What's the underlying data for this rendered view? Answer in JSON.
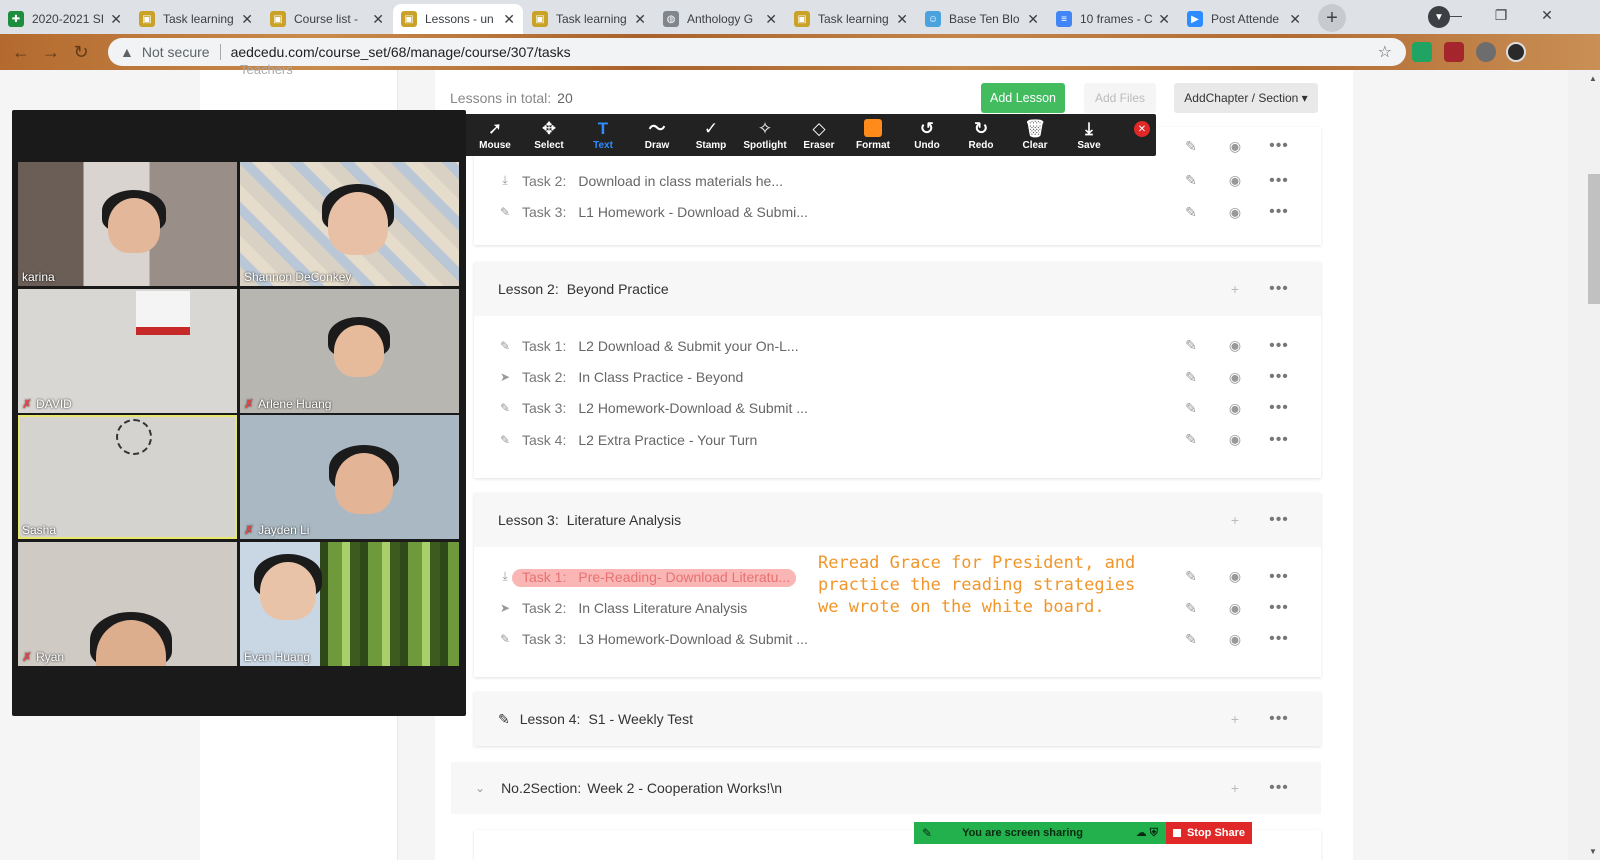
{
  "browser": {
    "tabs": [
      {
        "title": "2020-2021 SI",
        "favicon_color": "#1e8e3e",
        "favicon_glyph": "✚",
        "active": false
      },
      {
        "title": "Task learning",
        "favicon_color": "#c9a227",
        "favicon_glyph": "▣",
        "active": false
      },
      {
        "title": "Course list -",
        "favicon_color": "#c9a227",
        "favicon_glyph": "▣",
        "active": false
      },
      {
        "title": "Lessons - un",
        "favicon_color": "#c9a227",
        "favicon_glyph": "▣",
        "active": true
      },
      {
        "title": "Task learning",
        "favicon_color": "#c9a227",
        "favicon_glyph": "▣",
        "active": false
      },
      {
        "title": "Anthology G",
        "favicon_color": "#80868b",
        "favicon_glyph": "◍",
        "active": false
      },
      {
        "title": "Task learning",
        "favicon_color": "#c9a227",
        "favicon_glyph": "▣",
        "active": false
      },
      {
        "title": "Base Ten Blo",
        "favicon_color": "#4aa3df",
        "favicon_glyph": "☺",
        "active": false
      },
      {
        "title": "10 frames - C",
        "favicon_color": "#4285f4",
        "favicon_glyph": "≡",
        "active": false
      },
      {
        "title": "Post Attende",
        "favicon_color": "#2d8cff",
        "favicon_glyph": "▶",
        "active": false
      }
    ],
    "address": {
      "security_label": "Not secure",
      "url": "aedcedu.com/course_set/68/manage/course/307/tasks"
    }
  },
  "page": {
    "sidebar_text": "Teachers",
    "lessons_total_label": "Lessons in total:",
    "lessons_total_value": "20",
    "buttons": {
      "add_lesson": "Add Lesson",
      "add_files": "Add Files",
      "add_chapter": "AddChapter / Section ▾"
    },
    "lesson1": {
      "tasks": [
        {
          "icon": "download-icon",
          "glyph": "⤓",
          "num": "Task 2:",
          "title": "Download in class materials he..."
        },
        {
          "icon": "pencil-icon",
          "glyph": "✎",
          "num": "Task 3:",
          "title": "L1 Homework - Download & Submi..."
        }
      ]
    },
    "lesson2": {
      "label": "Lesson 2:",
      "title": "Beyond Practice",
      "tasks": [
        {
          "icon": "pencil-icon",
          "glyph": "✎",
          "num": "Task 1:",
          "title": "L2 Download & Submit your On-L..."
        },
        {
          "icon": "send-icon",
          "glyph": "➤",
          "num": "Task 2:",
          "title": "In Class Practice - Beyond"
        },
        {
          "icon": "pencil-icon",
          "glyph": "✎",
          "num": "Task 3:",
          "title": "L2 Homework-Download & Submit ..."
        },
        {
          "icon": "pencil-icon",
          "glyph": "✎",
          "num": "Task 4:",
          "title": "L2 Extra Practice - Your Turn"
        }
      ]
    },
    "lesson3": {
      "label": "Lesson 3:",
      "title": "Literature Analysis",
      "tasks": [
        {
          "icon": "download-icon",
          "glyph": "⤓",
          "num": "Task 1:",
          "title": "Pre-Reading- Download Literatu..."
        },
        {
          "icon": "send-icon",
          "glyph": "➤",
          "num": "Task 2:",
          "title": "In Class Literature Analysis"
        },
        {
          "icon": "pencil-icon",
          "glyph": "✎",
          "num": "Task 3:",
          "title": "L3 Homework-Download & Submit ..."
        }
      ]
    },
    "lesson4": {
      "label": "Lesson 4:",
      "title": "S1 - Weekly Test"
    },
    "section2": {
      "label": "No.2Section:",
      "title": "Week 2 - Cooperation Works!\\n"
    },
    "annotation": {
      "line1": "Reread Grace for President, and",
      "line2": "practice the reading strategies",
      "line3": "we wrote on the white board.",
      "color": "#f0962a"
    }
  },
  "annotate_toolbar": {
    "tools": [
      {
        "name": "mouse",
        "label": "Mouse",
        "glyph": "➚"
      },
      {
        "name": "select",
        "label": "Select",
        "glyph": "✥"
      },
      {
        "name": "text",
        "label": "Text",
        "glyph": "T",
        "active": true
      },
      {
        "name": "draw",
        "label": "Draw",
        "glyph": "〜"
      },
      {
        "name": "stamp",
        "label": "Stamp",
        "glyph": "✓"
      },
      {
        "name": "spotlight",
        "label": "Spotlight",
        "glyph": "✧"
      },
      {
        "name": "eraser",
        "label": "Eraser",
        "glyph": "◇"
      },
      {
        "name": "format",
        "label": "Format",
        "glyph": ""
      },
      {
        "name": "undo",
        "label": "Undo",
        "glyph": "↺"
      },
      {
        "name": "redo",
        "label": "Redo",
        "glyph": "↻"
      },
      {
        "name": "clear",
        "label": "Clear",
        "glyph": "🗑"
      },
      {
        "name": "save",
        "label": "Save",
        "glyph": "⤓"
      }
    ]
  },
  "zoom_gallery": {
    "participants": [
      {
        "name": "karina",
        "muted": false,
        "bg": "#8a7b72"
      },
      {
        "name": "Shannon DeConkey",
        "muted": false,
        "bg": "#c9c2b6"
      },
      {
        "name": "DAVID",
        "muted": true,
        "bg": "#d9d7d3"
      },
      {
        "name": "Arlene Huang",
        "muted": true,
        "bg": "#b8b6b1"
      },
      {
        "name": "Sasha",
        "muted": false,
        "bg": "#d5d3d0"
      },
      {
        "name": "Jayden Li",
        "muted": true,
        "bg": "#a9b8c2"
      },
      {
        "name": "Ryan",
        "muted": true,
        "bg": "#cfcac4"
      },
      {
        "name": "Evan Huang",
        "muted": false,
        "bg": "#4e6b2c"
      }
    ]
  },
  "share_banner": {
    "status": "You are screen sharing",
    "stop": "Stop Share"
  }
}
